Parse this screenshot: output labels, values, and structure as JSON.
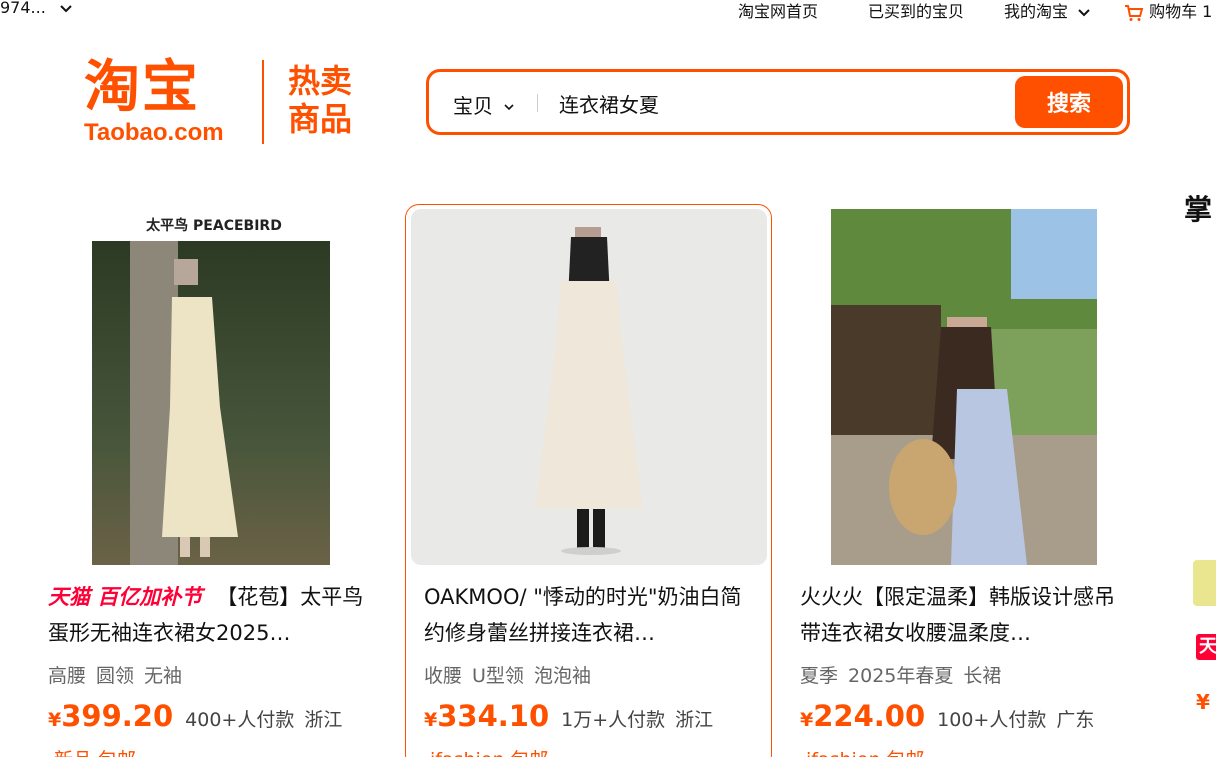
{
  "topbar": {
    "account": "974...",
    "links": [
      "淘宝网首页",
      "已买到的宝贝",
      "我的淘宝",
      "购物车 1"
    ]
  },
  "header": {
    "logo_cn": "淘宝",
    "logo_en": "Taobao.com",
    "logo_sub_line1": "热卖",
    "logo_sub_line2": "商品",
    "brand_color": "#ff5000"
  },
  "search": {
    "category": "宝贝",
    "value": "连衣裙女夏",
    "button": "搜索"
  },
  "products": [
    {
      "badge": "天猫 百亿加补节",
      "title": "【花苞】太平鸟蛋形无袖连衣裙女2025…",
      "image_caption": "太平鸟 PEACEBIRD",
      "tags": [
        "高腰",
        "圆领",
        "无袖"
      ],
      "yen": "¥",
      "price": "399.20",
      "sales": "400+人付款",
      "location": "浙江",
      "extra": "新品 包邮"
    },
    {
      "badge": "",
      "title": "OAKMOO/ \"悸动的时光\"奶油白简约修身蕾丝拼接连衣裙…",
      "image_caption": "",
      "tags": [
        "收腰",
        "U型领",
        "泡泡袖"
      ],
      "yen": "¥",
      "price": "334.10",
      "sales": "1万+人付款",
      "location": "浙江",
      "extra": "ifashion 包邮"
    },
    {
      "badge": "",
      "title": "火火火【限定温柔】韩版设计感吊带连衣裙女收腰温柔度…",
      "image_caption": "",
      "tags": [
        "夏季",
        "2025年春夏",
        "长裙"
      ],
      "yen": "¥",
      "price": "224.00",
      "sales": "100+人付款",
      "location": "广东",
      "extra": "ifashion 包邮"
    }
  ],
  "right_panel": {
    "title": "掌",
    "badge": "天",
    "yen": "¥"
  }
}
